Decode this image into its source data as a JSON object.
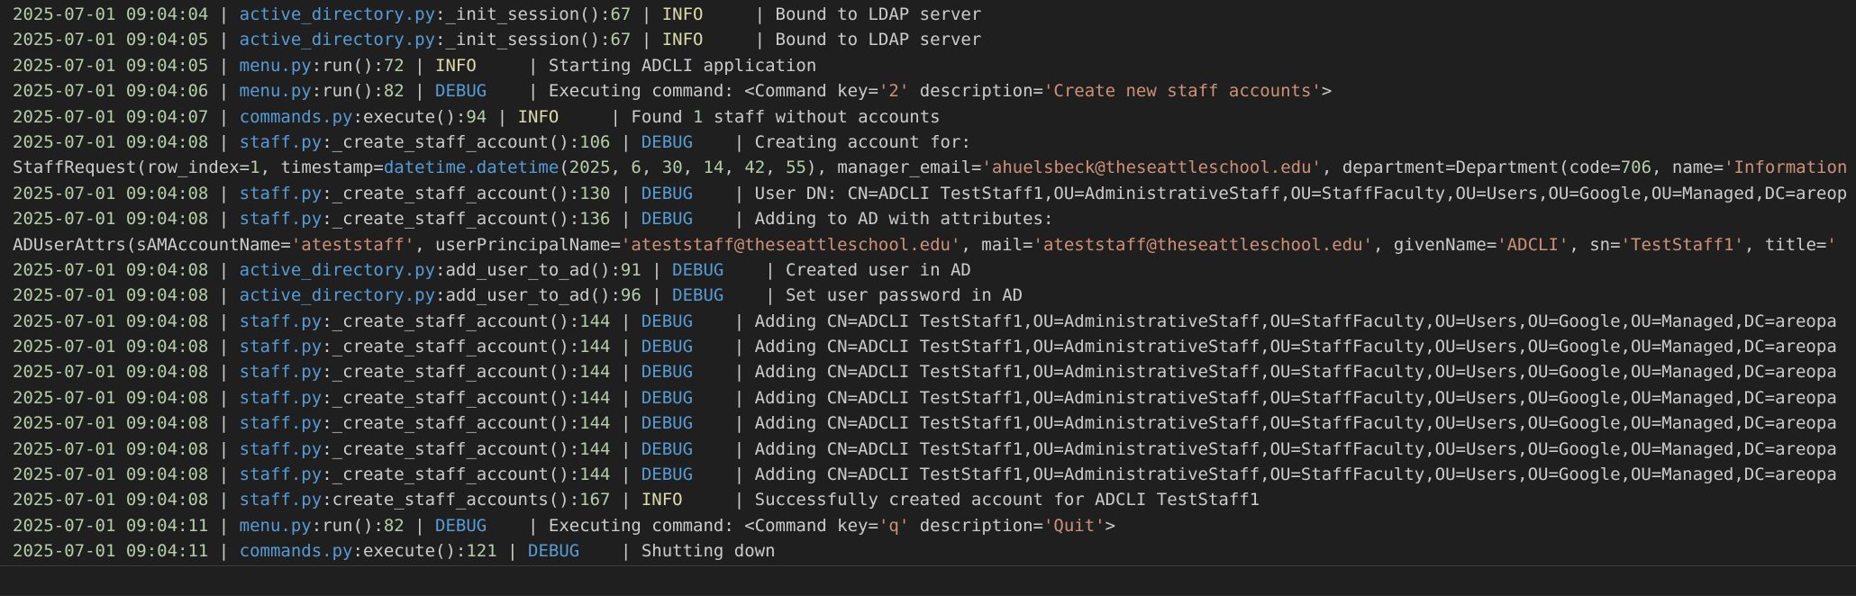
{
  "colors": {
    "background": "#1f1f1f",
    "timestamp": "#b5cea8",
    "file": "#569cd6",
    "number": "#b5cea8",
    "info": "#dcdcaa",
    "debug": "#569cd6",
    "string": "#ce9178",
    "text": "#cccccc"
  },
  "lines": [
    [
      [
        "ts",
        "2025-07-01 09:04:04"
      ],
      [
        "plain",
        " | "
      ],
      [
        "file",
        "active_directory.py"
      ],
      [
        "plain",
        ":_init_session():"
      ],
      [
        "num",
        "67"
      ],
      [
        "plain",
        " | "
      ],
      [
        "info",
        "INFO    "
      ],
      [
        "plain",
        " | Bound to LDAP server"
      ]
    ],
    [
      [
        "ts",
        "2025-07-01 09:04:05"
      ],
      [
        "plain",
        " | "
      ],
      [
        "file",
        "active_directory.py"
      ],
      [
        "plain",
        ":_init_session():"
      ],
      [
        "num",
        "67"
      ],
      [
        "plain",
        " | "
      ],
      [
        "info",
        "INFO    "
      ],
      [
        "plain",
        " | Bound to LDAP server"
      ]
    ],
    [
      [
        "ts",
        "2025-07-01 09:04:05"
      ],
      [
        "plain",
        " | "
      ],
      [
        "file",
        "menu.py"
      ],
      [
        "plain",
        ":run():"
      ],
      [
        "num",
        "72"
      ],
      [
        "plain",
        " | "
      ],
      [
        "info",
        "INFO    "
      ],
      [
        "plain",
        " | Starting ADCLI application"
      ]
    ],
    [
      [
        "ts",
        "2025-07-01 09:04:06"
      ],
      [
        "plain",
        " | "
      ],
      [
        "file",
        "menu.py"
      ],
      [
        "plain",
        ":run():"
      ],
      [
        "num",
        "82"
      ],
      [
        "plain",
        " | "
      ],
      [
        "debug",
        "DEBUG   "
      ],
      [
        "plain",
        " | Executing command: <Command key="
      ],
      [
        "str",
        "'2'"
      ],
      [
        "plain",
        " description="
      ],
      [
        "str",
        "'Create new staff accounts'"
      ],
      [
        "plain",
        ">"
      ]
    ],
    [
      [
        "ts",
        "2025-07-01 09:04:07"
      ],
      [
        "plain",
        " | "
      ],
      [
        "file",
        "commands.py"
      ],
      [
        "plain",
        ":execute():"
      ],
      [
        "num",
        "94"
      ],
      [
        "plain",
        " | "
      ],
      [
        "info",
        "INFO    "
      ],
      [
        "plain",
        " | Found "
      ],
      [
        "num",
        "1"
      ],
      [
        "plain",
        " staff without accounts"
      ]
    ],
    [
      [
        "ts",
        "2025-07-01 09:04:08"
      ],
      [
        "plain",
        " | "
      ],
      [
        "file",
        "staff.py"
      ],
      [
        "plain",
        ":_create_staff_account():"
      ],
      [
        "num",
        "106"
      ],
      [
        "plain",
        " | "
      ],
      [
        "debug",
        "DEBUG   "
      ],
      [
        "plain",
        " | Creating account for:"
      ]
    ],
    [
      [
        "plain",
        "StaffRequest(row_index="
      ],
      [
        "num",
        "1"
      ],
      [
        "plain",
        ", timestamp="
      ],
      [
        "file",
        "datetime.datetime"
      ],
      [
        "plain",
        "("
      ],
      [
        "num",
        "2025"
      ],
      [
        "plain",
        ", "
      ],
      [
        "num",
        "6"
      ],
      [
        "plain",
        ", "
      ],
      [
        "num",
        "30"
      ],
      [
        "plain",
        ", "
      ],
      [
        "num",
        "14"
      ],
      [
        "plain",
        ", "
      ],
      [
        "num",
        "42"
      ],
      [
        "plain",
        ", "
      ],
      [
        "num",
        "55"
      ],
      [
        "plain",
        "), manager_email="
      ],
      [
        "str",
        "'ahuelsbeck@theseattleschool.edu'"
      ],
      [
        "plain",
        ", department=Department(code="
      ],
      [
        "num",
        "706"
      ],
      [
        "plain",
        ", name="
      ],
      [
        "str",
        "'Information"
      ]
    ],
    [
      [
        "ts",
        "2025-07-01 09:04:08"
      ],
      [
        "plain",
        " | "
      ],
      [
        "file",
        "staff.py"
      ],
      [
        "plain",
        ":_create_staff_account():"
      ],
      [
        "num",
        "130"
      ],
      [
        "plain",
        " | "
      ],
      [
        "debug",
        "DEBUG   "
      ],
      [
        "plain",
        " | User DN: CN=ADCLI TestStaff1,OU=AdministrativeStaff,OU=StaffFaculty,OU=Users,OU=Google,OU=Managed,DC=areop"
      ]
    ],
    [
      [
        "ts",
        "2025-07-01 09:04:08"
      ],
      [
        "plain",
        " | "
      ],
      [
        "file",
        "staff.py"
      ],
      [
        "plain",
        ":_create_staff_account():"
      ],
      [
        "num",
        "136"
      ],
      [
        "plain",
        " | "
      ],
      [
        "debug",
        "DEBUG   "
      ],
      [
        "plain",
        " | Adding to AD with attributes:"
      ]
    ],
    [
      [
        "plain",
        "ADUserAttrs(sAMAccountName="
      ],
      [
        "str",
        "'ateststaff'"
      ],
      [
        "plain",
        ", userPrincipalName="
      ],
      [
        "str",
        "'ateststaff@theseattleschool.edu'"
      ],
      [
        "plain",
        ", mail="
      ],
      [
        "str",
        "'ateststaff@theseattleschool.edu'"
      ],
      [
        "plain",
        ", givenName="
      ],
      [
        "str",
        "'ADCLI'"
      ],
      [
        "plain",
        ", sn="
      ],
      [
        "str",
        "'TestStaff1'"
      ],
      [
        "plain",
        ", title="
      ],
      [
        "str",
        "'"
      ]
    ],
    [
      [
        "ts",
        "2025-07-01 09:04:08"
      ],
      [
        "plain",
        " | "
      ],
      [
        "file",
        "active_directory.py"
      ],
      [
        "plain",
        ":add_user_to_ad():"
      ],
      [
        "num",
        "91"
      ],
      [
        "plain",
        " | "
      ],
      [
        "debug",
        "DEBUG   "
      ],
      [
        "plain",
        " | Created user in AD"
      ]
    ],
    [
      [
        "ts",
        "2025-07-01 09:04:08"
      ],
      [
        "plain",
        " | "
      ],
      [
        "file",
        "active_directory.py"
      ],
      [
        "plain",
        ":add_user_to_ad():"
      ],
      [
        "num",
        "96"
      ],
      [
        "plain",
        " | "
      ],
      [
        "debug",
        "DEBUG   "
      ],
      [
        "plain",
        " | Set user password in AD"
      ]
    ],
    [
      [
        "ts",
        "2025-07-01 09:04:08"
      ],
      [
        "plain",
        " | "
      ],
      [
        "file",
        "staff.py"
      ],
      [
        "plain",
        ":_create_staff_account():"
      ],
      [
        "num",
        "144"
      ],
      [
        "plain",
        " | "
      ],
      [
        "debug",
        "DEBUG   "
      ],
      [
        "plain",
        " | Adding CN=ADCLI TestStaff1,OU=AdministrativeStaff,OU=StaffFaculty,OU=Users,OU=Google,OU=Managed,DC=areopa"
      ]
    ],
    [
      [
        "ts",
        "2025-07-01 09:04:08"
      ],
      [
        "plain",
        " | "
      ],
      [
        "file",
        "staff.py"
      ],
      [
        "plain",
        ":_create_staff_account():"
      ],
      [
        "num",
        "144"
      ],
      [
        "plain",
        " | "
      ],
      [
        "debug",
        "DEBUG   "
      ],
      [
        "plain",
        " | Adding CN=ADCLI TestStaff1,OU=AdministrativeStaff,OU=StaffFaculty,OU=Users,OU=Google,OU=Managed,DC=areopa"
      ]
    ],
    [
      [
        "ts",
        "2025-07-01 09:04:08"
      ],
      [
        "plain",
        " | "
      ],
      [
        "file",
        "staff.py"
      ],
      [
        "plain",
        ":_create_staff_account():"
      ],
      [
        "num",
        "144"
      ],
      [
        "plain",
        " | "
      ],
      [
        "debug",
        "DEBUG   "
      ],
      [
        "plain",
        " | Adding CN=ADCLI TestStaff1,OU=AdministrativeStaff,OU=StaffFaculty,OU=Users,OU=Google,OU=Managed,DC=areopa"
      ]
    ],
    [
      [
        "ts",
        "2025-07-01 09:04:08"
      ],
      [
        "plain",
        " | "
      ],
      [
        "file",
        "staff.py"
      ],
      [
        "plain",
        ":_create_staff_account():"
      ],
      [
        "num",
        "144"
      ],
      [
        "plain",
        " | "
      ],
      [
        "debug",
        "DEBUG   "
      ],
      [
        "plain",
        " | Adding CN=ADCLI TestStaff1,OU=AdministrativeStaff,OU=StaffFaculty,OU=Users,OU=Google,OU=Managed,DC=areopa"
      ]
    ],
    [
      [
        "ts",
        "2025-07-01 09:04:08"
      ],
      [
        "plain",
        " | "
      ],
      [
        "file",
        "staff.py"
      ],
      [
        "plain",
        ":_create_staff_account():"
      ],
      [
        "num",
        "144"
      ],
      [
        "plain",
        " | "
      ],
      [
        "debug",
        "DEBUG   "
      ],
      [
        "plain",
        " | Adding CN=ADCLI TestStaff1,OU=AdministrativeStaff,OU=StaffFaculty,OU=Users,OU=Google,OU=Managed,DC=areopa"
      ]
    ],
    [
      [
        "ts",
        "2025-07-01 09:04:08"
      ],
      [
        "plain",
        " | "
      ],
      [
        "file",
        "staff.py"
      ],
      [
        "plain",
        ":_create_staff_account():"
      ],
      [
        "num",
        "144"
      ],
      [
        "plain",
        " | "
      ],
      [
        "debug",
        "DEBUG   "
      ],
      [
        "plain",
        " | Adding CN=ADCLI TestStaff1,OU=AdministrativeStaff,OU=StaffFaculty,OU=Users,OU=Google,OU=Managed,DC=areopa"
      ]
    ],
    [
      [
        "ts",
        "2025-07-01 09:04:08"
      ],
      [
        "plain",
        " | "
      ],
      [
        "file",
        "staff.py"
      ],
      [
        "plain",
        ":_create_staff_account():"
      ],
      [
        "num",
        "144"
      ],
      [
        "plain",
        " | "
      ],
      [
        "debug",
        "DEBUG   "
      ],
      [
        "plain",
        " | Adding CN=ADCLI TestStaff1,OU=AdministrativeStaff,OU=StaffFaculty,OU=Users,OU=Google,OU=Managed,DC=areopa"
      ]
    ],
    [
      [
        "ts",
        "2025-07-01 09:04:08"
      ],
      [
        "plain",
        " | "
      ],
      [
        "file",
        "staff.py"
      ],
      [
        "plain",
        ":create_staff_accounts():"
      ],
      [
        "num",
        "167"
      ],
      [
        "plain",
        " | "
      ],
      [
        "info",
        "INFO    "
      ],
      [
        "plain",
        " | Successfully created account for ADCLI TestStaff1"
      ]
    ],
    [
      [
        "ts",
        "2025-07-01 09:04:11"
      ],
      [
        "plain",
        " | "
      ],
      [
        "file",
        "menu.py"
      ],
      [
        "plain",
        ":run():"
      ],
      [
        "num",
        "82"
      ],
      [
        "plain",
        " | "
      ],
      [
        "debug",
        "DEBUG   "
      ],
      [
        "plain",
        " | Executing command: <Command key="
      ],
      [
        "str",
        "'q'"
      ],
      [
        "plain",
        " description="
      ],
      [
        "str",
        "'Quit'"
      ],
      [
        "plain",
        ">"
      ]
    ],
    [
      [
        "ts",
        "2025-07-01 09:04:11"
      ],
      [
        "plain",
        " | "
      ],
      [
        "file",
        "commands.py"
      ],
      [
        "plain",
        ":execute():"
      ],
      [
        "num",
        "121"
      ],
      [
        "plain",
        " | "
      ],
      [
        "debug",
        "DEBUG   "
      ],
      [
        "plain",
        " | Shutting down"
      ]
    ]
  ]
}
